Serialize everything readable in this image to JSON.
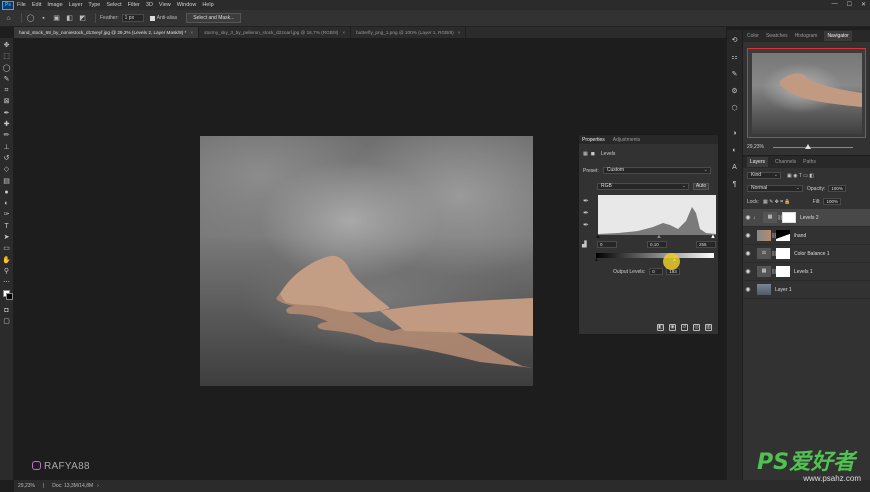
{
  "menubar": {
    "app_icon": "Ps",
    "items": [
      "File",
      "Edit",
      "Image",
      "Layer",
      "Type",
      "Select",
      "Filter",
      "3D",
      "View",
      "Window",
      "Help"
    ]
  },
  "options": {
    "feather_label": "Feather:",
    "feather_value": "1 px",
    "antialias_label": "Anti-alias",
    "select_mask_label": "Select and Mask..."
  },
  "tabs": [
    {
      "label": "hand_stock_68_by_noniestock_d13veyf.jpg @ 29,2% (Levels 2, Layer Mask/8) *",
      "active": true
    },
    {
      "label": "stormy_sky_3_by_pelleron_stock_d22oarl.jpg @ 16,7% (RGB/8)",
      "active": false
    },
    {
      "label": "butterfly_png_1.png @ 100% (Layer 1, RGB/8)",
      "active": false
    }
  ],
  "properties": {
    "tab_properties": "Properties",
    "tab_adjustments": "Adjustments",
    "title": "Levels",
    "preset_label": "Preset:",
    "preset_value": "Custom",
    "channel_value": "RGB",
    "auto_label": "Auto",
    "input_black": "0",
    "input_gamma": "0,10",
    "input_white": "255",
    "output_label": "Output Levels:",
    "output_black": "0",
    "output_white": "193"
  },
  "navigator": {
    "tabs": [
      "Color",
      "Swatches",
      "Histogram",
      "Navigator"
    ],
    "zoom": "29,23%"
  },
  "layers": {
    "tabs": [
      "Layers",
      "Channels",
      "Paths"
    ],
    "kind_label": "Kind",
    "blend_mode": "Normal",
    "opacity_label": "Opacity:",
    "opacity_value": "100%",
    "lock_label": "Lock:",
    "fill_label": "Fill:",
    "fill_value": "100%",
    "rows": [
      {
        "name": "Levels 2",
        "selected": true
      },
      {
        "name": "ihand",
        "selected": false
      },
      {
        "name": "Color Balance 1",
        "selected": false
      },
      {
        "name": "Levels 1",
        "selected": false
      },
      {
        "name": "Layer 1",
        "selected": false
      }
    ]
  },
  "status": {
    "zoom": "29,23%",
    "doc": "Doc: 13,3M/14,8M"
  },
  "watermark": {
    "user": "RAFYA88",
    "site_big": "PS爱好者",
    "site_small": "www.psahz.com"
  },
  "colors": {
    "accent": "#31a8ff",
    "panel": "#323232",
    "canvas_bg": "#1d1d1d",
    "cursor_highlight": "#ebcd28",
    "nav_frame": "#dd3333"
  }
}
